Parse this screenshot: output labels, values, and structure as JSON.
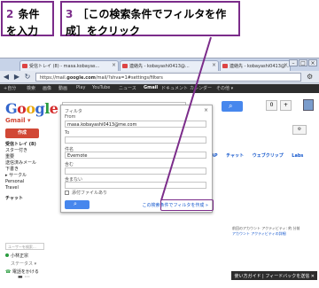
{
  "callouts": {
    "step2": {
      "num": "2",
      "text": "条件を入力"
    },
    "step3": {
      "num": "3",
      "text": "［この検索条件でフィルタを作成］をクリック"
    }
  },
  "browser": {
    "tabs": [
      {
        "label": "受信トレイ (8) - masa.kobayas..."
      },
      {
        "label": "連絡先 - kobayashi0413@..."
      },
      {
        "label": "連絡先 - kobayashi0413@..."
      }
    ],
    "url_prefix": "https://mail.",
    "url_host": "google.com",
    "url_rest": "/mail/?shva=1#settings/filters"
  },
  "gbar": {
    "items": [
      "+自分",
      "検索",
      "画像",
      "動画",
      "Play",
      "YouTube",
      "ニュース",
      "Gmail",
      "ドキュメント",
      "カレンダー",
      "その他 ▾"
    ]
  },
  "gmail": {
    "label": "Gmail ▾",
    "compose": "作成",
    "sidebar": [
      "受信トレイ (8)",
      "スター付き",
      "重要",
      "送信済みメール",
      "下書き",
      "▸ サークル",
      "Personal",
      "Travel"
    ],
    "chat_label": "チャット",
    "chat_search_placeholder": "ユーザーを検索...",
    "contacts": [
      "小林正宗",
      "ステータス ▾"
    ],
    "call_label": "電話をかける",
    "tabs": [
      "AP",
      "チャット",
      "ウェブクリップ",
      "Labs"
    ],
    "account_count": "0",
    "right_info": [
      "前回のアカウント アクティビティ: 約 分前",
      "アカウント アクティビティの詳細"
    ]
  },
  "dialog": {
    "title": "フィルタ",
    "from_label": "From",
    "from_value": "masa.kobayashi0413@me.com",
    "to_label": "To",
    "subject_label": "件名",
    "subject_value": "Evernote",
    "has_label": "含む",
    "hasnot_label": "含まない",
    "attachment_label": "添付ファイルあり",
    "create_link": "この検索条件でフィルタを作成 »"
  },
  "footer": {
    "feedback": "使い方ガイド | フィードバックを送信 ✕"
  }
}
